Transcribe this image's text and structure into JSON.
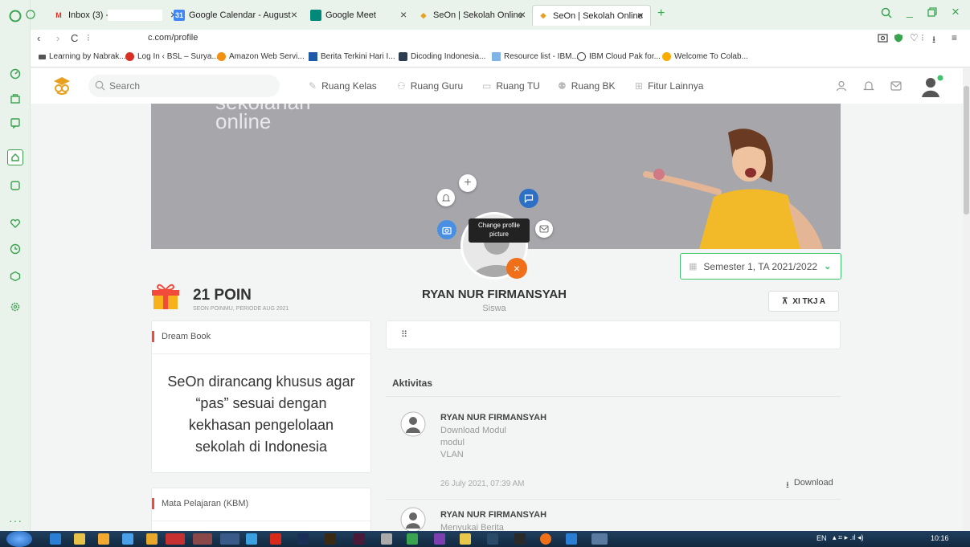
{
  "browser": {
    "tabs": [
      {
        "label": "Inbox (3) -",
        "icon": "gmail-icon"
      },
      {
        "label": "Google Calendar - August",
        "icon": "calendar-icon"
      },
      {
        "label": "Google Meet",
        "icon": "meet-icon"
      },
      {
        "label": "SeOn | Sekolah Online",
        "icon": "seon-icon"
      },
      {
        "label": "SeOn | Sekolah Online",
        "icon": "seon-icon"
      }
    ],
    "url": "c.com/profile",
    "bookmarks": [
      "Learning by Nabrak...",
      "Log In ‹ BSL – Surya...",
      "Amazon Web Servi...",
      "Berita Terkini Hari I...",
      "Dicoding Indonesia...",
      "Resource list - IBM...",
      "IBM Cloud Pak for...",
      "Welcome To Colab..."
    ]
  },
  "site": {
    "search_placeholder": "Search",
    "nav": [
      "Ruang Kelas",
      "Ruang Guru",
      "Ruang TU",
      "Ruang BK",
      "Fitur Lainnya"
    ]
  },
  "cover": {
    "brand_line1": "sekolahan",
    "brand_line2": "online"
  },
  "profile": {
    "tooltip": "Change profile picture",
    "name": "RYAN NUR FIRMANSYAH",
    "role": "Siswa",
    "semester": "Semester 1, TA 2021/2022",
    "class": "XI TKJ A",
    "points": "21 POIN",
    "points_sub": "SEON POINMU, PERIODE AUG 2021"
  },
  "dream_book": {
    "title": "Dream Book",
    "text": "SeOn dirancang khusus agar “pas” sesuai dengan kekhasan pengelolaan sekolah di Indonesia"
  },
  "mapel": {
    "title": "Mata Pelajaran  (KBM)"
  },
  "activity": {
    "title": "Aktivitas",
    "items": [
      {
        "user": "RYAN NUR FIRMANSYAH",
        "action": "Download Modul",
        "line2": "modul",
        "line3": "VLAN",
        "time": "26 July 2021, 07:39 AM",
        "link": "Download"
      },
      {
        "user": "RYAN NUR FIRMANSYAH",
        "action": "Menyukai Berita"
      }
    ]
  },
  "taskbar": {
    "lang": "EN",
    "time": "10:16"
  }
}
